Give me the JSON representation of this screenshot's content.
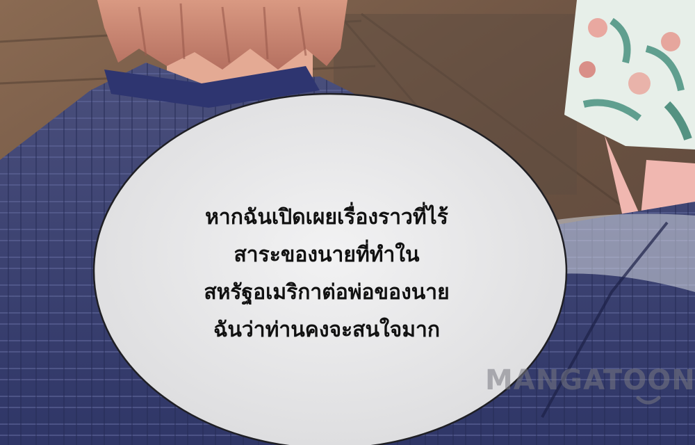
{
  "panel": {
    "dialogue_lines": [
      "หากฉันเปิดเผยเรื่องราวที่ไร้",
      "สาระของนายที่ทำใน",
      "สหรัฐอเมริกาต่อพ่อของนาย",
      "ฉันว่าท่านคงจะสนใจมาก"
    ],
    "watermark": "MANGATOON"
  },
  "colors": {
    "bubble": "#e9e9ea",
    "suit": "#3b4272",
    "hair": "#c4826c",
    "wood": "#6f5a4a",
    "dress_floral": "#e8f0ec"
  }
}
